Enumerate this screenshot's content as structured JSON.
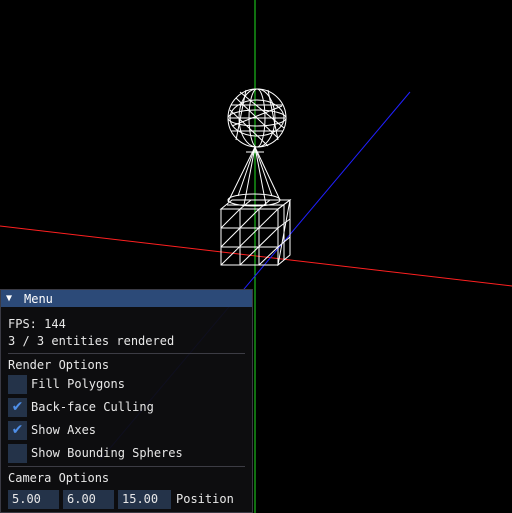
{
  "window": {
    "title": "Menu",
    "collapse_icon": "triangle-down-icon"
  },
  "stats": {
    "fps": "FPS: 144",
    "entities": "3 / 3 entities rendered"
  },
  "render_options": {
    "header": "Render Options",
    "items": [
      {
        "label": "Fill Polygons",
        "checked": false
      },
      {
        "label": "Back-face Culling",
        "checked": true
      },
      {
        "label": "Show Axes",
        "checked": true
      },
      {
        "label": "Show Bounding Spheres",
        "checked": false
      }
    ]
  },
  "camera_options": {
    "header": "Camera Options",
    "position": [
      "5.00",
      "6.00",
      "15.00"
    ],
    "position_label": "Position"
  },
  "colors": {
    "x_axis": "#ff2020",
    "y_axis": "#20e020",
    "z_axis": "#2020ff",
    "wireframe": "#ffffff",
    "title_bar": "#2c4a78",
    "checkmark": "#4f8fe8"
  }
}
